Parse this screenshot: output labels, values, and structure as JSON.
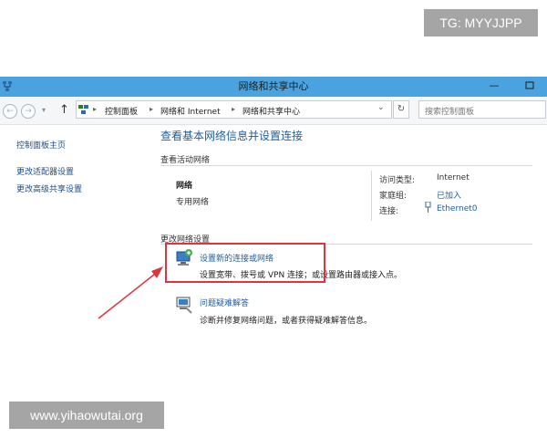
{
  "watermark_top": "TG: MYYJJPP",
  "watermark_bottom": "www.yihaowutai.org",
  "window": {
    "title": "网络和共享中心",
    "minimize": "—"
  },
  "nav": {
    "back": "←",
    "forward": "→",
    "dropdown": "▾",
    "up": "↑",
    "breadcrumb": [
      "控制面板",
      "网络和 Internet",
      "网络和共享中心"
    ],
    "breadcrumb_sep": "▸",
    "addr_dropdown": "⌄",
    "refresh": "↻",
    "search_placeholder": "搜索控制面板"
  },
  "sidebar": {
    "home": "控制面板主页",
    "links": [
      "更改适配器设置",
      "更改高级共享设置"
    ]
  },
  "main": {
    "heading": "查看基本网络信息并设置连接",
    "active_networks_label": "查看活动网络",
    "network_name": "网络",
    "network_type": "专用网络",
    "info": [
      {
        "key": "访问类型:",
        "value": "Internet",
        "link": false
      },
      {
        "key": "家庭组:",
        "value": "已加入",
        "link": true
      },
      {
        "key": "连接:",
        "value": "Ethernet0",
        "link": true
      }
    ],
    "change_settings_label": "更改网络设置",
    "tasks": [
      {
        "title": "设置新的连接或网络",
        "desc": "设置宽带、拨号或 VPN 连接；或设置路由器或接入点。"
      },
      {
        "title": "问题疑难解答",
        "desc": "诊断并修复网络问题，或者获得疑难解答信息。"
      }
    ]
  },
  "colors": {
    "titlebar": "#4aa3df",
    "link": "#1f5fa0",
    "highlight": "#e0333d"
  }
}
